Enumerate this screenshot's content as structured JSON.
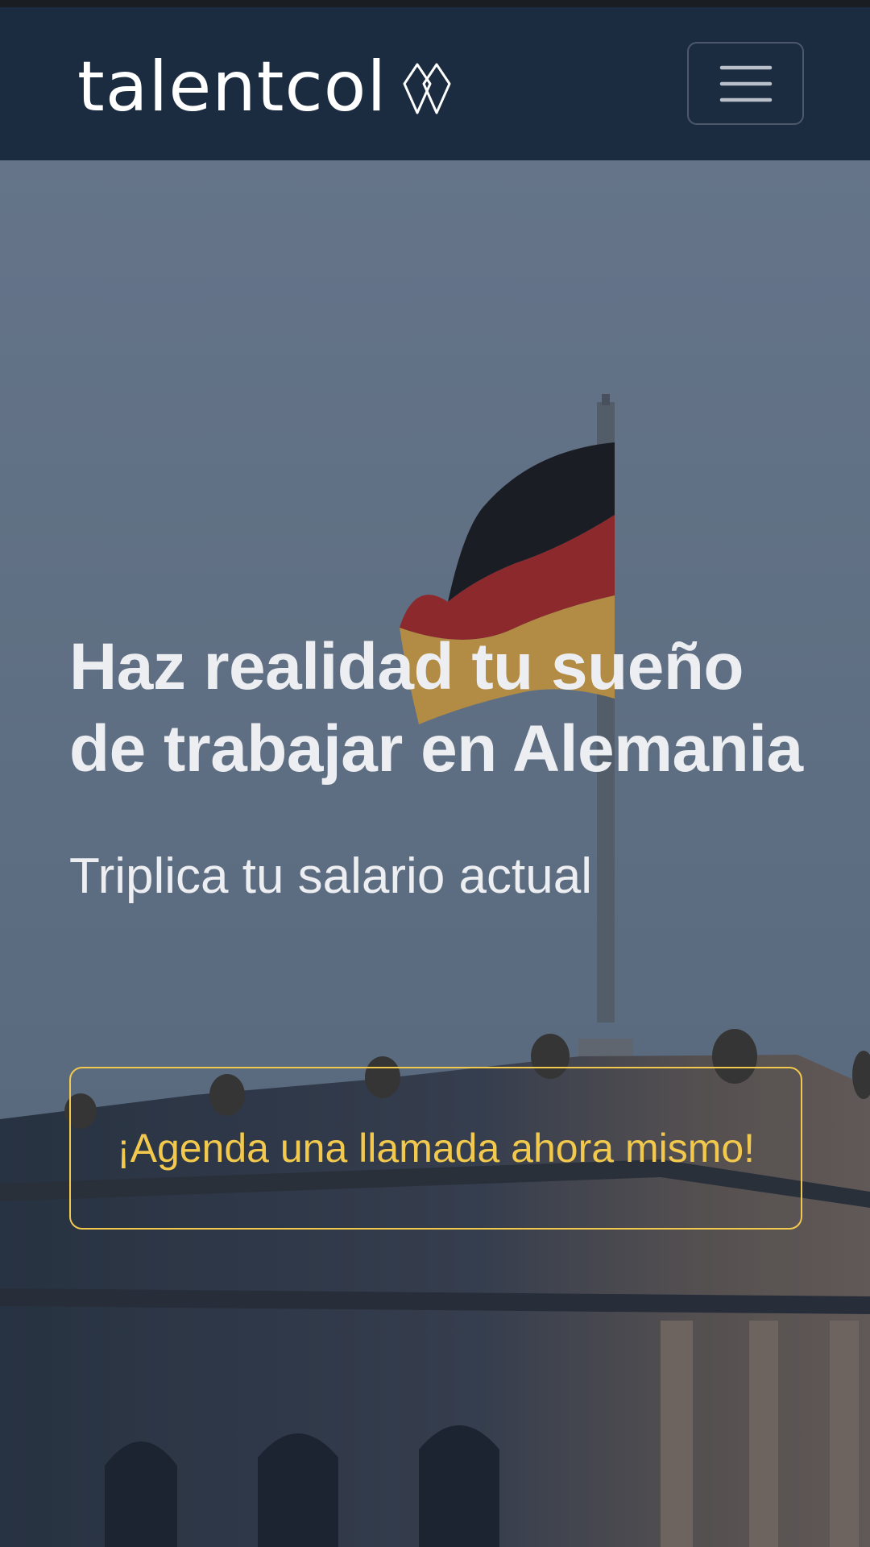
{
  "navbar": {
    "brand": "talentcol",
    "brand_icon": "diamond-logo-icon",
    "menu_icon": "hamburger-menu-icon",
    "background_color": "#1b2b40"
  },
  "hero": {
    "title": "Haz realidad tu sueño de trabajar en Alemania",
    "subtitle": "Triplica tu salario actual",
    "cta_label": "¡Agenda una llamada ahora mismo!",
    "accent_color": "#f2c94c",
    "background_scene": [
      "german-flag",
      "building-facade"
    ]
  }
}
